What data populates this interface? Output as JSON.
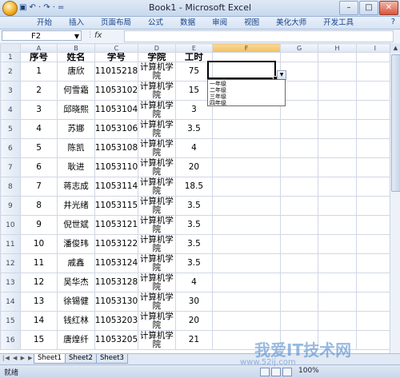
{
  "window": {
    "title": "Book1 - Microsoft Excel"
  },
  "quick_access": {
    "save": "▣",
    "undo": "↶ ·",
    "redo": "↷ ·",
    "more": "="
  },
  "ribbon": {
    "tabs": [
      "开始",
      "插入",
      "页面布局",
      "公式",
      "数据",
      "审阅",
      "视图",
      "美化大师",
      "开发工具"
    ],
    "help": "?"
  },
  "formula_bar": {
    "name_box": "F2",
    "fx": "fx",
    "value": ""
  },
  "columns": [
    "A",
    "B",
    "C",
    "D",
    "E",
    "F",
    "G",
    "H",
    "I"
  ],
  "rows": [
    {
      "n": "1",
      "a": "序号",
      "b": "姓名",
      "c": "学号",
      "d": "学院",
      "e": "工时"
    },
    {
      "n": "2",
      "a": "1",
      "b": "唐欣",
      "c": "11015218",
      "d": "计算机学院",
      "e": "75"
    },
    {
      "n": "3",
      "a": "2",
      "b": "何雪霜",
      "c": "11053102",
      "d": "计算机学院",
      "e": "15"
    },
    {
      "n": "4",
      "a": "3",
      "b": "邱晓熙",
      "c": "11053104",
      "d": "计算机学院",
      "e": "3"
    },
    {
      "n": "5",
      "a": "4",
      "b": "苏娜",
      "c": "11053106",
      "d": "计算机学院",
      "e": "3.5"
    },
    {
      "n": "6",
      "a": "5",
      "b": "陈凯",
      "c": "11053108",
      "d": "计算机学院",
      "e": "4"
    },
    {
      "n": "7",
      "a": "6",
      "b": "耿进",
      "c": "11053110",
      "d": "计算机学院",
      "e": "20"
    },
    {
      "n": "8",
      "a": "7",
      "b": "蒋志成",
      "c": "11053114",
      "d": "计算机学院",
      "e": "18.5"
    },
    {
      "n": "9",
      "a": "8",
      "b": "井光绪",
      "c": "11053115",
      "d": "计算机学院",
      "e": "3.5"
    },
    {
      "n": "10",
      "a": "9",
      "b": "倪世斌",
      "c": "11053121",
      "d": "计算机学院",
      "e": "3.5"
    },
    {
      "n": "11",
      "a": "10",
      "b": "潘俊玮",
      "c": "11053122",
      "d": "计算机学院",
      "e": "3.5"
    },
    {
      "n": "12",
      "a": "11",
      "b": "戚鑫",
      "c": "11053124",
      "d": "计算机学院",
      "e": "3.5"
    },
    {
      "n": "13",
      "a": "12",
      "b": "吴华杰",
      "c": "11053128",
      "d": "计算机学院",
      "e": "4"
    },
    {
      "n": "14",
      "a": "13",
      "b": "徐锡健",
      "c": "11053130",
      "d": "计算机学院",
      "e": "30"
    },
    {
      "n": "15",
      "a": "14",
      "b": "钱红林",
      "c": "11053203",
      "d": "计算机学院",
      "e": "20"
    },
    {
      "n": "16",
      "a": "15",
      "b": "唐煌纤",
      "c": "11053205",
      "d": "计算机学院",
      "e": "21"
    }
  ],
  "dropdown": {
    "options": [
      "一年级",
      "二年级",
      "三年级",
      "四年级"
    ]
  },
  "sheets": [
    "Sheet1",
    "Sheet2",
    "Sheet3"
  ],
  "status": {
    "ready": "就绪",
    "zoom": "100%"
  },
  "watermark": {
    "main": "我爱IT技术网",
    "sub": "www.52ij.com"
  }
}
